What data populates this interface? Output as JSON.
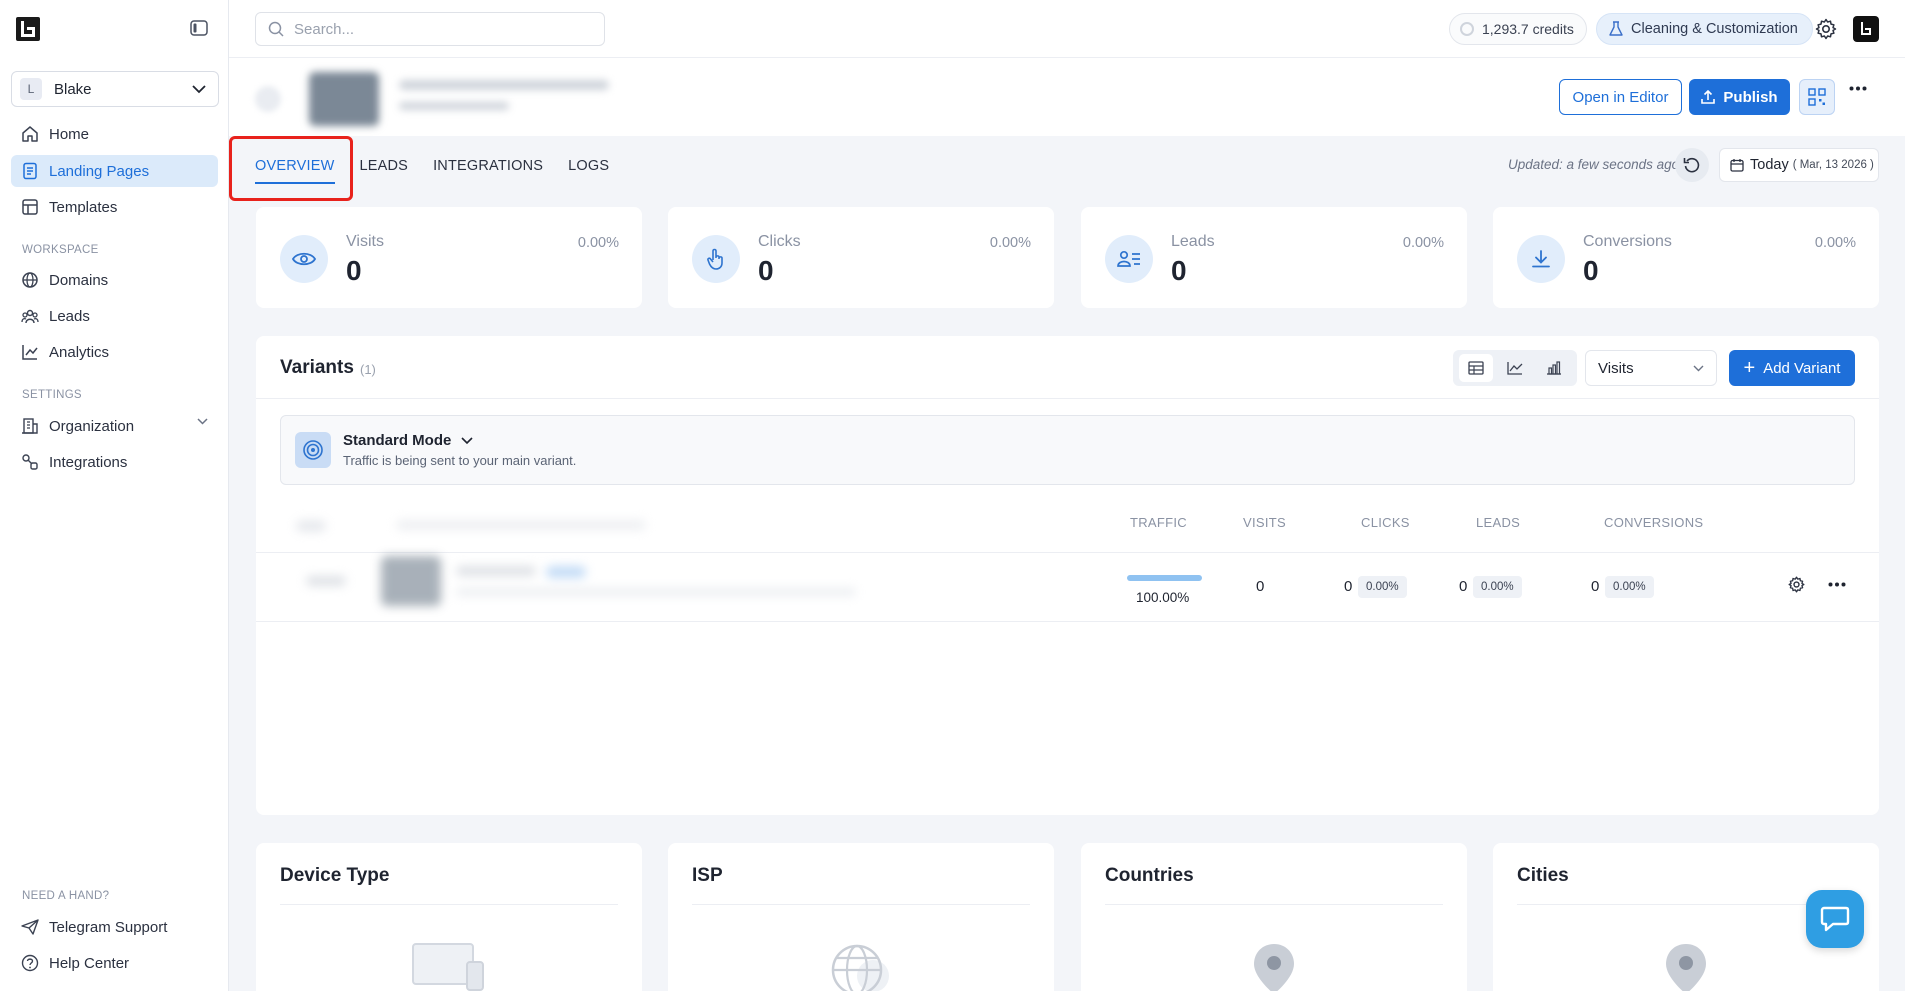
{
  "sidebar": {
    "workspace": {
      "avatar": "L",
      "name": "Blake"
    },
    "main_items": [
      {
        "label": "Home",
        "icon": "home-icon"
      },
      {
        "label": "Landing Pages",
        "icon": "landing-pages-icon",
        "active": true
      },
      {
        "label": "Templates",
        "icon": "templates-icon"
      }
    ],
    "workspace_label": "WORKSPACE",
    "workspace_items": [
      {
        "label": "Domains",
        "icon": "globe-icon"
      },
      {
        "label": "Leads",
        "icon": "users-icon"
      },
      {
        "label": "Analytics",
        "icon": "chart-line-icon"
      }
    ],
    "settings_label": "SETTINGS",
    "settings_items": [
      {
        "label": "Organization",
        "icon": "building-icon"
      },
      {
        "label": "Integrations",
        "icon": "integrations-icon"
      }
    ],
    "help_label": "NEED A HAND?",
    "help_items": [
      {
        "label": "Telegram Support",
        "icon": "send-icon"
      },
      {
        "label": "Help Center",
        "icon": "question-icon"
      }
    ]
  },
  "topbar": {
    "search_placeholder": "Search...",
    "credits": "1,293.7 credits",
    "plan": "Cleaning & Customization"
  },
  "header": {
    "open_editor": "Open in Editor",
    "publish": "Publish"
  },
  "tabs": [
    {
      "label": "OVERVIEW",
      "active": true
    },
    {
      "label": "LEADS"
    },
    {
      "label": "INTEGRATIONS"
    },
    {
      "label": "LOGS"
    }
  ],
  "toolbar": {
    "updated": "Updated: a few seconds ago",
    "date_label": "Today",
    "date_value": "( Mar, 13 2026 )"
  },
  "stats": [
    {
      "label": "Visits",
      "value": "0",
      "pct": "0.00%",
      "icon": "eye-icon"
    },
    {
      "label": "Clicks",
      "value": "0",
      "pct": "0.00%",
      "icon": "pointer-icon"
    },
    {
      "label": "Leads",
      "value": "0",
      "pct": "0.00%",
      "icon": "user-list-icon"
    },
    {
      "label": "Conversions",
      "value": "0",
      "pct": "0.00%",
      "icon": "download-icon"
    }
  ],
  "variants": {
    "title": "Variants",
    "count": "(1)",
    "metric": "Visits",
    "add_label": "Add Variant",
    "mode_title": "Standard Mode",
    "mode_subtitle": "Traffic is being sent to your main variant.",
    "columns": [
      "TRAFFIC",
      "VISITS",
      "CLICKS",
      "LEADS",
      "CONVERSIONS"
    ],
    "row": {
      "traffic": "100.00%",
      "traffic_fraction": 1.0,
      "visits": "0",
      "clicks": "0",
      "clicks_pct": "0.00%",
      "leads": "0",
      "leads_pct": "0.00%",
      "conversions": "0",
      "conversions_pct": "0.00%"
    }
  },
  "bottom_cards": [
    {
      "title": "Device Type",
      "icon": "devices-icon"
    },
    {
      "title": "ISP",
      "icon": "globe-icon"
    },
    {
      "title": "Countries",
      "icon": "map-pin-icon"
    },
    {
      "title": "Cities",
      "icon": "map-pin-icon"
    }
  ],
  "colors": {
    "accent": "#1e6fd9",
    "highlight": "#e8221c",
    "chat": "#2f9ee3"
  }
}
